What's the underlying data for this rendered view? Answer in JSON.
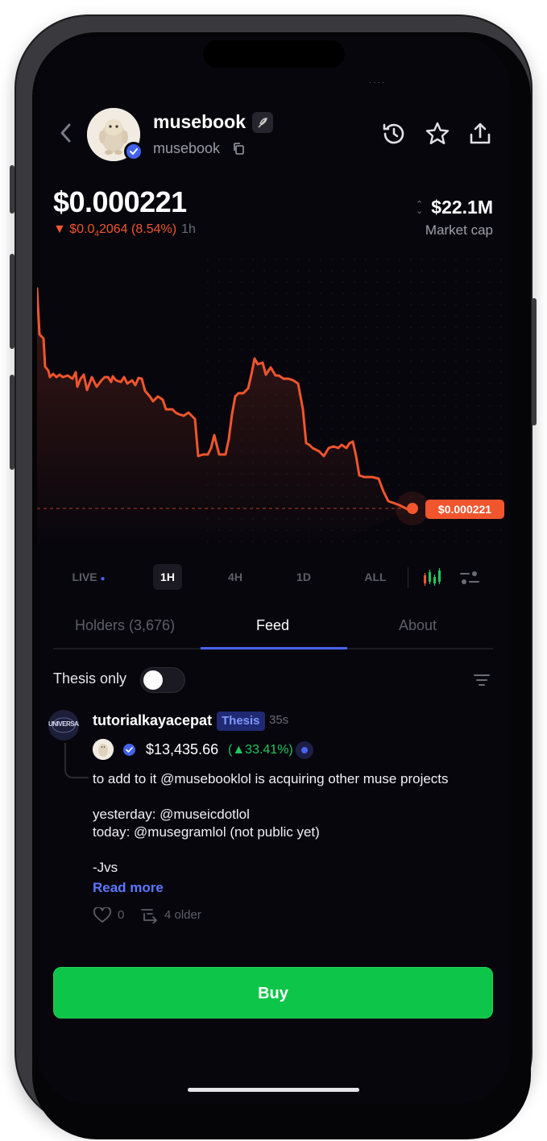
{
  "header": {
    "token_name": "musebook",
    "token_handle": "musebook"
  },
  "price": {
    "current": "$0.000221",
    "change_prefix": "▼ $0.0",
    "change_subscript": "4",
    "change_suffix": "2064 (8.54%)",
    "timeframe": "1h",
    "market_cap_value": "$22.1M",
    "market_cap_label": "Market cap",
    "tag": "$0.000221"
  },
  "timeframes": [
    {
      "label": "LIVE"
    },
    {
      "label": "1H"
    },
    {
      "label": "4H"
    },
    {
      "label": "1D"
    },
    {
      "label": "ALL"
    }
  ],
  "tabs": [
    {
      "label": "Holders (3,676)"
    },
    {
      "label": "Feed"
    },
    {
      "label": "About"
    }
  ],
  "filter": {
    "thesis_label": "Thesis only",
    "thesis_enabled": false
  },
  "post": {
    "avatar_text": "UNIVERSAL",
    "author": "tutorialkayacepat",
    "badge": "Thesis",
    "time": "35s",
    "holding_value": "$13,435.66",
    "holding_pct": "(▲33.41%)",
    "lines": [
      "to add to it @musebooklol is acquiring other muse projects",
      "",
      "yesterday: @museicdotlol",
      "today: @musegramlol (not public yet)",
      "",
      "-Jvs"
    ],
    "read_more": "Read more",
    "likes": "0",
    "older": "4 older"
  },
  "buy_label": "Buy",
  "colors": {
    "accent_red": "#f0552e",
    "accent_green": "#0dc548",
    "accent_blue": "#4a63f0",
    "background": "#07060d"
  },
  "icons": [
    "back-icon",
    "feather-icon",
    "copy-icon",
    "history-icon",
    "star-icon",
    "share-icon",
    "candles-icon",
    "settings-icon",
    "filter-icon",
    "heart-icon",
    "thread-icon"
  ]
}
